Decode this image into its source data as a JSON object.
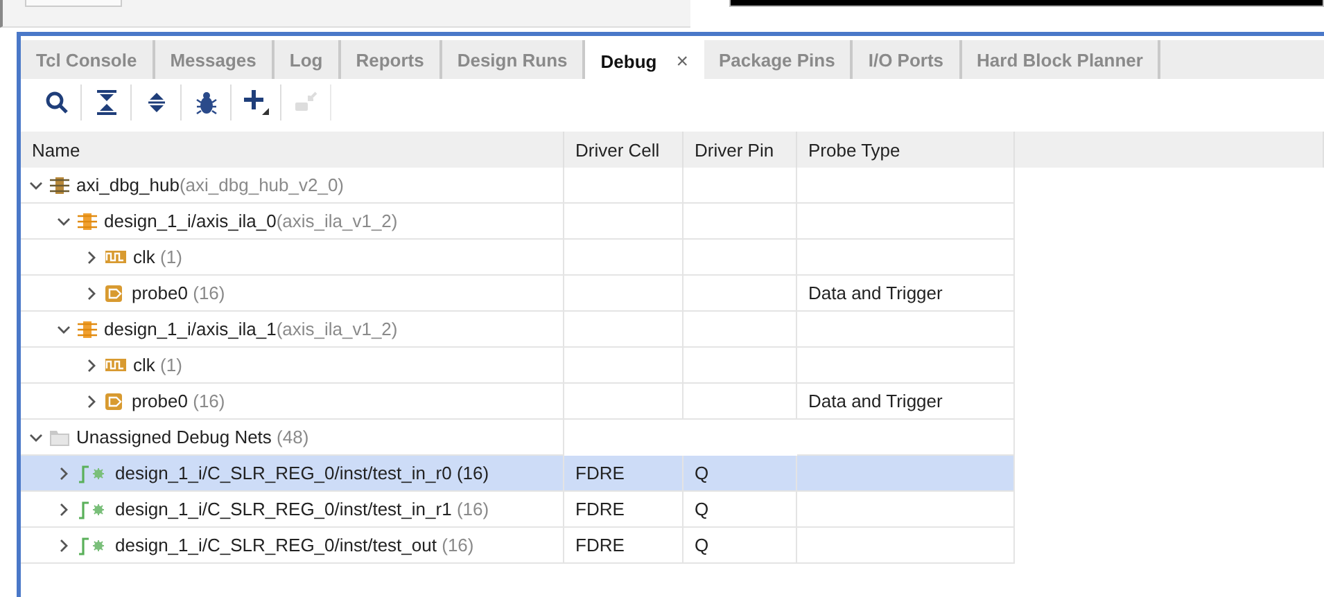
{
  "tabs": [
    {
      "label": "Tcl Console",
      "selected": false,
      "closable": false
    },
    {
      "label": "Messages",
      "selected": false,
      "closable": false
    },
    {
      "label": "Log",
      "selected": false,
      "closable": false
    },
    {
      "label": "Reports",
      "selected": false,
      "closable": false
    },
    {
      "label": "Design Runs",
      "selected": false,
      "closable": false
    },
    {
      "label": "Debug",
      "selected": true,
      "closable": true,
      "close_glyph": "×"
    },
    {
      "label": "Package Pins",
      "selected": false,
      "closable": false
    },
    {
      "label": "I/O Ports",
      "selected": false,
      "closable": false
    },
    {
      "label": "Hard Block Planner",
      "selected": false,
      "closable": false
    }
  ],
  "toolbar": [
    {
      "kind": "search",
      "disabled": false
    },
    {
      "kind": "collapse",
      "disabled": false
    },
    {
      "kind": "expand",
      "disabled": false
    },
    {
      "kind": "bug",
      "disabled": false
    },
    {
      "kind": "add",
      "disabled": false
    },
    {
      "kind": "assign",
      "disabled": true
    }
  ],
  "table": {
    "columns": [
      "Name",
      "Driver Cell",
      "Driver Pin",
      "Probe Type"
    ],
    "rows": [
      {
        "kind": "hub",
        "name": "axi_dbg_hub",
        "detail": "(axi_dbg_hub_v2_0)",
        "expanded": true,
        "selected": false,
        "children": [
          {
            "kind": "ila",
            "name": "design_1_i/axis_ila_0",
            "detail": "(axis_ila_v1_2)",
            "expanded": true,
            "selected": false,
            "children": [
              {
                "kind": "clock",
                "name": "clk",
                "detail": "(1)",
                "expanded": false,
                "selected": false
              },
              {
                "kind": "probe",
                "name": "probe0",
                "detail": "(16)",
                "expanded": false,
                "selected": false,
                "probe_type": "Data and Trigger"
              }
            ]
          },
          {
            "kind": "ila",
            "name": "design_1_i/axis_ila_1",
            "detail": "(axis_ila_v1_2)",
            "expanded": true,
            "selected": false,
            "children": [
              {
                "kind": "clock",
                "name": "clk",
                "detail": "(1)",
                "expanded": false,
                "selected": false
              },
              {
                "kind": "probe",
                "name": "probe0",
                "detail": "(16)",
                "expanded": false,
                "selected": false,
                "probe_type": "Data and Trigger"
              }
            ]
          }
        ]
      },
      {
        "kind": "folder",
        "name": "Unassigned Debug Nets",
        "detail": "(48)",
        "expanded": true,
        "selected": false,
        "children": [
          {
            "kind": "net",
            "name": "design_1_i/C_SLR_REG_0/inst/test_in_r0",
            "detail": "(16)",
            "expanded": false,
            "selected": true,
            "driver_cell": "FDRE",
            "driver_pin": "Q"
          },
          {
            "kind": "net",
            "name": "design_1_i/C_SLR_REG_0/inst/test_in_r1",
            "detail": "(16)",
            "expanded": false,
            "selected": false,
            "driver_cell": "FDRE",
            "driver_pin": "Q"
          },
          {
            "kind": "net",
            "name": "design_1_i/C_SLR_REG_0/inst/test_out",
            "detail": "(16)",
            "expanded": false,
            "selected": false,
            "driver_cell": "FDRE",
            "driver_pin": "Q"
          }
        ]
      }
    ]
  }
}
